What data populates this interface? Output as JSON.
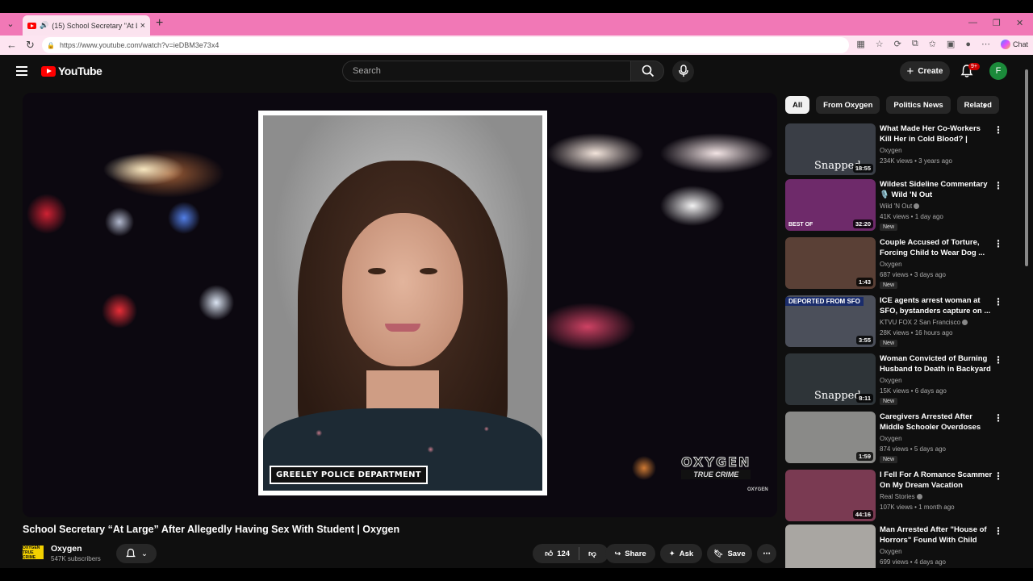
{
  "browser": {
    "tab_title": "(15) School Secretary \"At Large\" After Allegedly Having Sex With Student | Oxygen",
    "tab_title_visible": "(15) School Secretary \"At Larg",
    "url": "https://www.youtube.com/watch?v=ieDBM3e73x4",
    "chat_label": "Chat"
  },
  "header": {
    "logo_text": "YouTube",
    "search_placeholder": "Search",
    "create_label": "Create",
    "notifications_badge": "9+",
    "avatar_letter": "F"
  },
  "player": {
    "overlay_caption": "GREELEY POLICE DEPARTMENT",
    "brand_line1": "OXYGEN",
    "brand_line2": "TRUE CRIME",
    "brand_small": "OXYGEN"
  },
  "video": {
    "title": "School Secretary “At Large” After Allegedly Having Sex With Student | Oxygen",
    "channel_name": "Oxygen",
    "channel_logo_text": "OXYGEN TRUE CRIME",
    "subscribers": "547K subscribers",
    "likes": "124",
    "share_label": "Share",
    "ask_label": "Ask",
    "save_label": "Save"
  },
  "chips": [
    "All",
    "From Oxygen",
    "Politics News",
    "Related"
  ],
  "recommendations": [
    {
      "title": "What Made Her Co-Workers Kill Her in Cold Blood? | Snapped ...",
      "channel": "Oxygen",
      "verified": false,
      "meta": "234K views • 3 years ago",
      "duration": "18:55",
      "badge_new": false,
      "thumb_label": "Snapped",
      "thumb_color": "#3a3e46"
    },
    {
      "title": "Wildest Sideline Commentary 🎙️ Wild 'N Out",
      "channel": "Wild 'N Out",
      "verified": true,
      "meta": "41K views • 1 day ago",
      "duration": "32:20",
      "badge_new": true,
      "thumb_label": "BEST OF",
      "thumb_color": "#6e2a6a"
    },
    {
      "title": "Couple Accused of Torture, Forcing Child to Wear Dog ...",
      "channel": "Oxygen",
      "verified": false,
      "meta": "687 views • 3 days ago",
      "duration": "1:43",
      "badge_new": true,
      "thumb_label": "",
      "thumb_color": "#5a4036"
    },
    {
      "title": "ICE agents arrest woman at SFO, bystanders capture on ...",
      "channel": "KTVU FOX 2 San Francisco",
      "verified": true,
      "meta": "28K views • 16 hours ago",
      "duration": "3:55",
      "badge_new": true,
      "thumb_label": "DEPORTED FROM SFO",
      "thumb_color": "#4b4f5a"
    },
    {
      "title": "Woman Convicted of Burning Husband to Death in Backyard ...",
      "channel": "Oxygen",
      "verified": false,
      "meta": "15K views • 6 days ago",
      "duration": "8:11",
      "badge_new": true,
      "thumb_label": "Snapped",
      "thumb_color": "#2e3438"
    },
    {
      "title": "Caregivers Arrested After Middle Schooler Overdoses on...",
      "channel": "Oxygen",
      "verified": false,
      "meta": "874 views • 5 days ago",
      "duration": "1:59",
      "badge_new": true,
      "thumb_label": "",
      "thumb_color": "#8a8a88"
    },
    {
      "title": "I Fell For A Romance Scammer On My Dream Vacation",
      "channel": "Real Stories",
      "verified": true,
      "meta": "107K views • 1 month ago",
      "duration": "44:16",
      "badge_new": false,
      "thumb_label": "",
      "thumb_color": "#7a3a52"
    },
    {
      "title": "Man Arrested After \"House of Horrors\" Found With Child Sex...",
      "channel": "Oxygen",
      "verified": false,
      "meta": "699 views • 4 days ago",
      "duration": "",
      "badge_new": false,
      "thumb_label": "",
      "thumb_color": "#a9a6a2"
    }
  ],
  "colors": {
    "tabstrip": "#f178b6",
    "youtube_red": "#ff0000",
    "page_bg": "#0f0f0f"
  }
}
